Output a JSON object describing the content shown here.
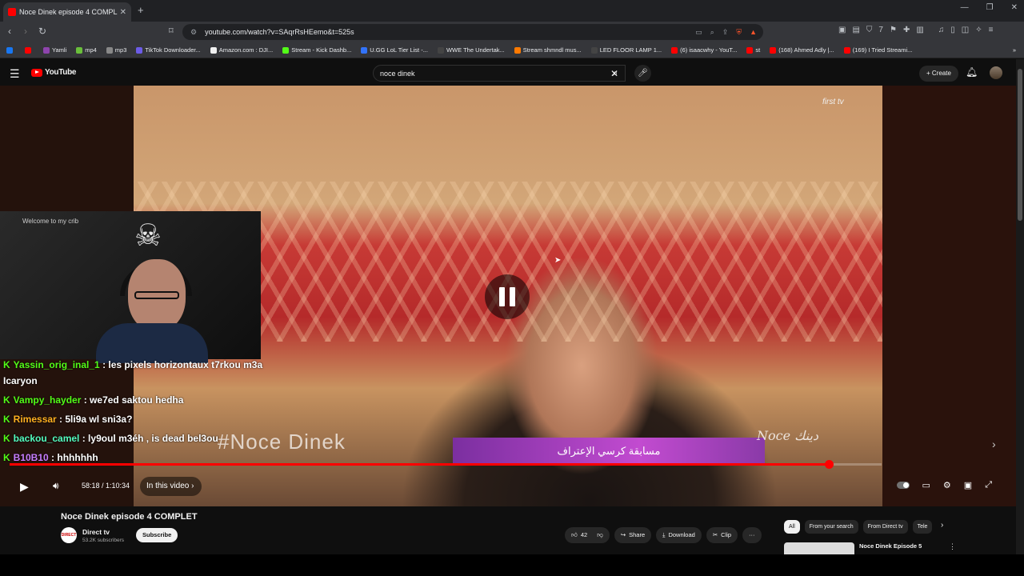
{
  "browser": {
    "tab_title": "Noce Dinek episode 4 COMPL",
    "tab_close": "✕",
    "new_tab": "+",
    "url": "youtube.com/watch?v=SAqrRsHEemo&t=525s",
    "bookmarks": [
      {
        "label": "",
        "color": "#1877f2"
      },
      {
        "label": "",
        "color": "#ff0000"
      },
      {
        "label": "Yamli",
        "color": "#8e44ad"
      },
      {
        "label": "mp4",
        "color": "#6abf3b"
      },
      {
        "label": "mp3",
        "color": "#888888"
      },
      {
        "label": "TikTok Downloader...",
        "color": "#6c5ce7"
      },
      {
        "label": "Amazon.com : DJI...",
        "color": "#f0f0f0"
      },
      {
        "label": "Stream - Kick Dashb...",
        "color": "#53fc18"
      },
      {
        "label": "U.GG LoL Tier List -...",
        "color": "#3273fa"
      },
      {
        "label": "WWE The Undertak...",
        "color": "#444444"
      },
      {
        "label": "Stream shmndl mus...",
        "color": "#ff7a00"
      },
      {
        "label": "LED FLOOR LAMP 1...",
        "color": "#444444"
      },
      {
        "label": "(6) isaacwhy - YouT...",
        "color": "#ff0000"
      },
      {
        "label": "st",
        "color": "#ff0000"
      },
      {
        "label": "(168) Ahmed Adly |...",
        "color": "#ff0000"
      },
      {
        "label": "(169) I Tried Streami...",
        "color": "#ff0000"
      }
    ],
    "bookmarks_more": "»"
  },
  "youtube": {
    "logo_text": "YouTube",
    "search_value": "noce dinek",
    "create_label": "+ Create"
  },
  "player": {
    "channel_watermark": "first tv",
    "hashtag": "#Noce  Dinek",
    "banner_text": "مسابقة كرسي الإعتراف",
    "signature": "Noce دينك",
    "progress_fraction": 0.94,
    "time_display": "58:18 / 1:10:34",
    "in_this_video": "In this video"
  },
  "webcam": {
    "welcome_text": "Welcome to my crib"
  },
  "chat": [
    {
      "user": "Yassin_orig_inal_1",
      "color": "#53fc18",
      "text": ": les pixels horizontaux t7rkou m3a Icaryon"
    },
    {
      "user": "Vampy_hayder",
      "color": "#53fc18",
      "text": ": we7ed saktou hedha"
    },
    {
      "user": "Rimessar",
      "color": "#ffb020",
      "text": ": 5li9a wl sni3a?"
    },
    {
      "user": "backou_camel",
      "color": "#53fcbf",
      "text": ": ly9oul m3éh , is dead bel3ou"
    },
    {
      "user": "B10B10",
      "color": "#c77dff",
      "text": ": hhhhhhh"
    }
  ],
  "video_info": {
    "title": "Noce Dinek episode 4 COMPLET",
    "channel_name": "Direct tv",
    "channel_avatar_text": "DIRECT",
    "subscribers": "53.2K subscribers",
    "subscribe_label": "Subscribe",
    "likes": "42",
    "share_label": "Share",
    "download_label": "Download",
    "clip_label": "Clip",
    "more_label": "···"
  },
  "related": {
    "chips": [
      "All",
      "From your search",
      "From Direct tv",
      "Tele"
    ],
    "first_title": "Noce Dinek Episode 5"
  }
}
